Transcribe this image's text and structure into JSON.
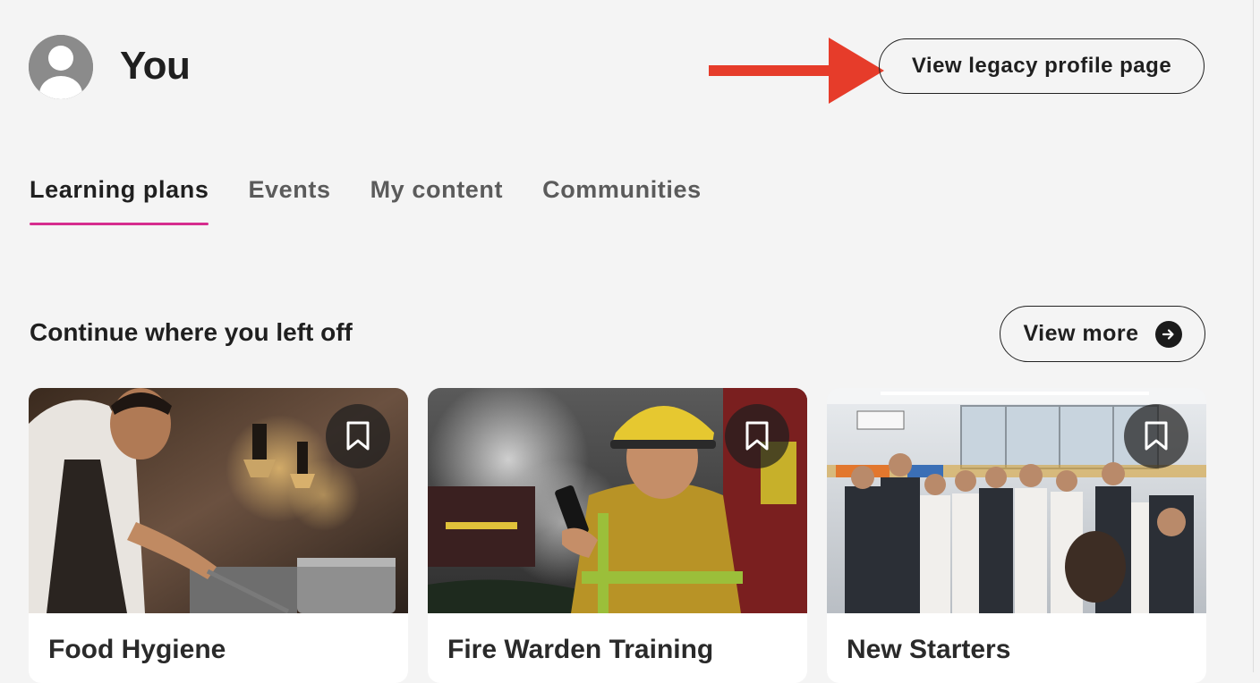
{
  "header": {
    "title": "You",
    "legacy_button_label": "View legacy profile page",
    "avatar_icon": "user-avatar-icon",
    "annotation_color": "#e63c2a"
  },
  "tabs": [
    {
      "label": "Learning plans",
      "active": true
    },
    {
      "label": "Events",
      "active": false
    },
    {
      "label": "My content",
      "active": false
    },
    {
      "label": "Communities",
      "active": false
    }
  ],
  "section": {
    "title": "Continue where you left off",
    "view_more_label": "View more",
    "view_more_icon": "arrow-right-circle-icon"
  },
  "cards": [
    {
      "title": "Food Hygiene",
      "image": "chef-cooking-in-kitchen",
      "bookmark_icon": "bookmark-icon"
    },
    {
      "title": "Fire Warden Training",
      "image": "fire-warden-with-radio",
      "bookmark_icon": "bookmark-icon"
    },
    {
      "title": "New Starters",
      "image": "team-in-open-plan-office",
      "bookmark_icon": "bookmark-icon"
    }
  ],
  "colors": {
    "background": "#f4f4f4",
    "tab_indicator": "#d62d8e",
    "text": "#1f1f1f",
    "tab_inactive": "#5b5b5b"
  }
}
